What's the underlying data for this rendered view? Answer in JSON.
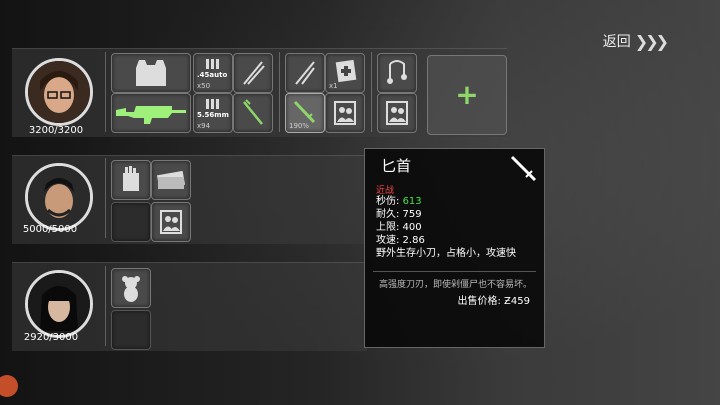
{
  "back_label": "返回",
  "back_arrows": "❯❯❯",
  "characters": [
    {
      "hp": "3200/3200"
    },
    {
      "hp": "5000/5000"
    },
    {
      "hp": "2920/3000"
    }
  ],
  "slots": {
    "ammo45_label": ".45auto",
    "ammo45_qty": "x50",
    "medkit_qty": "x1",
    "ammo556_label": "5.56mm",
    "ammo556_qty": "x94",
    "knife_pct": "190%"
  },
  "tooltip": {
    "title": "匕首",
    "category": "近战",
    "dps_label": "秒伤:",
    "dps_value": "613",
    "durability": "耐久: 759",
    "limit": "上限: 400",
    "speed": "攻速: 2.86",
    "feature": "野外生存小刀，占格小，攻速快",
    "description": "高强度刀刃，即使剁僵尸也不容易坏。",
    "price": "出售价格: Ƶ459"
  },
  "colors": {
    "accent_green": "#8fd66a",
    "dps_green": "#4be04b",
    "category_red": "#e44444"
  }
}
